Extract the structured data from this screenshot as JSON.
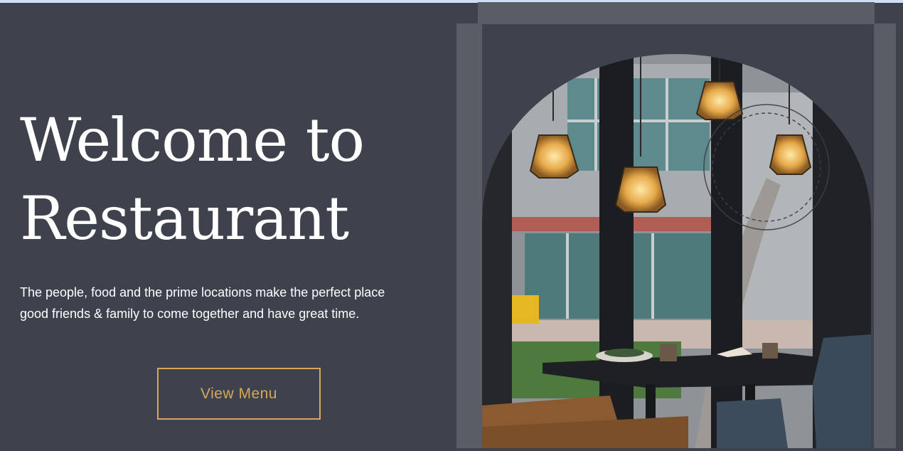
{
  "hero": {
    "title_line1": "Welcome to",
    "title_line2": "Restaurant",
    "text_line1": "The people, food and the prime locations make the perfect place",
    "text_line2": "good friends & family to come together and have great time.",
    "cta_label": "View Menu"
  },
  "colors": {
    "background": "#3d424d",
    "accent": "#d8a65a",
    "frame": "#595d66"
  },
  "image": {
    "icon": "restaurant-interior-image"
  }
}
